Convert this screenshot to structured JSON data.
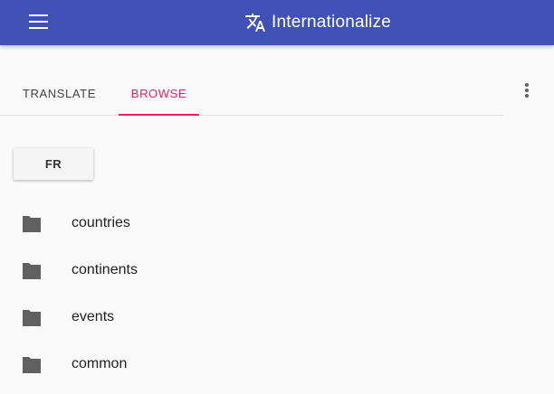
{
  "app": {
    "title": "Internationalize",
    "menu_icon": "menu-icon",
    "title_icon": "translate-icon",
    "colors": {
      "primary": "#3f51b5",
      "accent": "#e91e63"
    }
  },
  "tabs": [
    {
      "label": "TRANSLATE",
      "active": false
    },
    {
      "label": "BROWSE",
      "active": true
    }
  ],
  "overflow_menu_icon": "more-vert-icon",
  "language_button": {
    "label": "FR"
  },
  "folders": [
    {
      "name": "countries",
      "icon": "folder-icon"
    },
    {
      "name": "continents",
      "icon": "folder-icon"
    },
    {
      "name": "events",
      "icon": "folder-icon"
    },
    {
      "name": "common",
      "icon": "folder-icon"
    }
  ]
}
